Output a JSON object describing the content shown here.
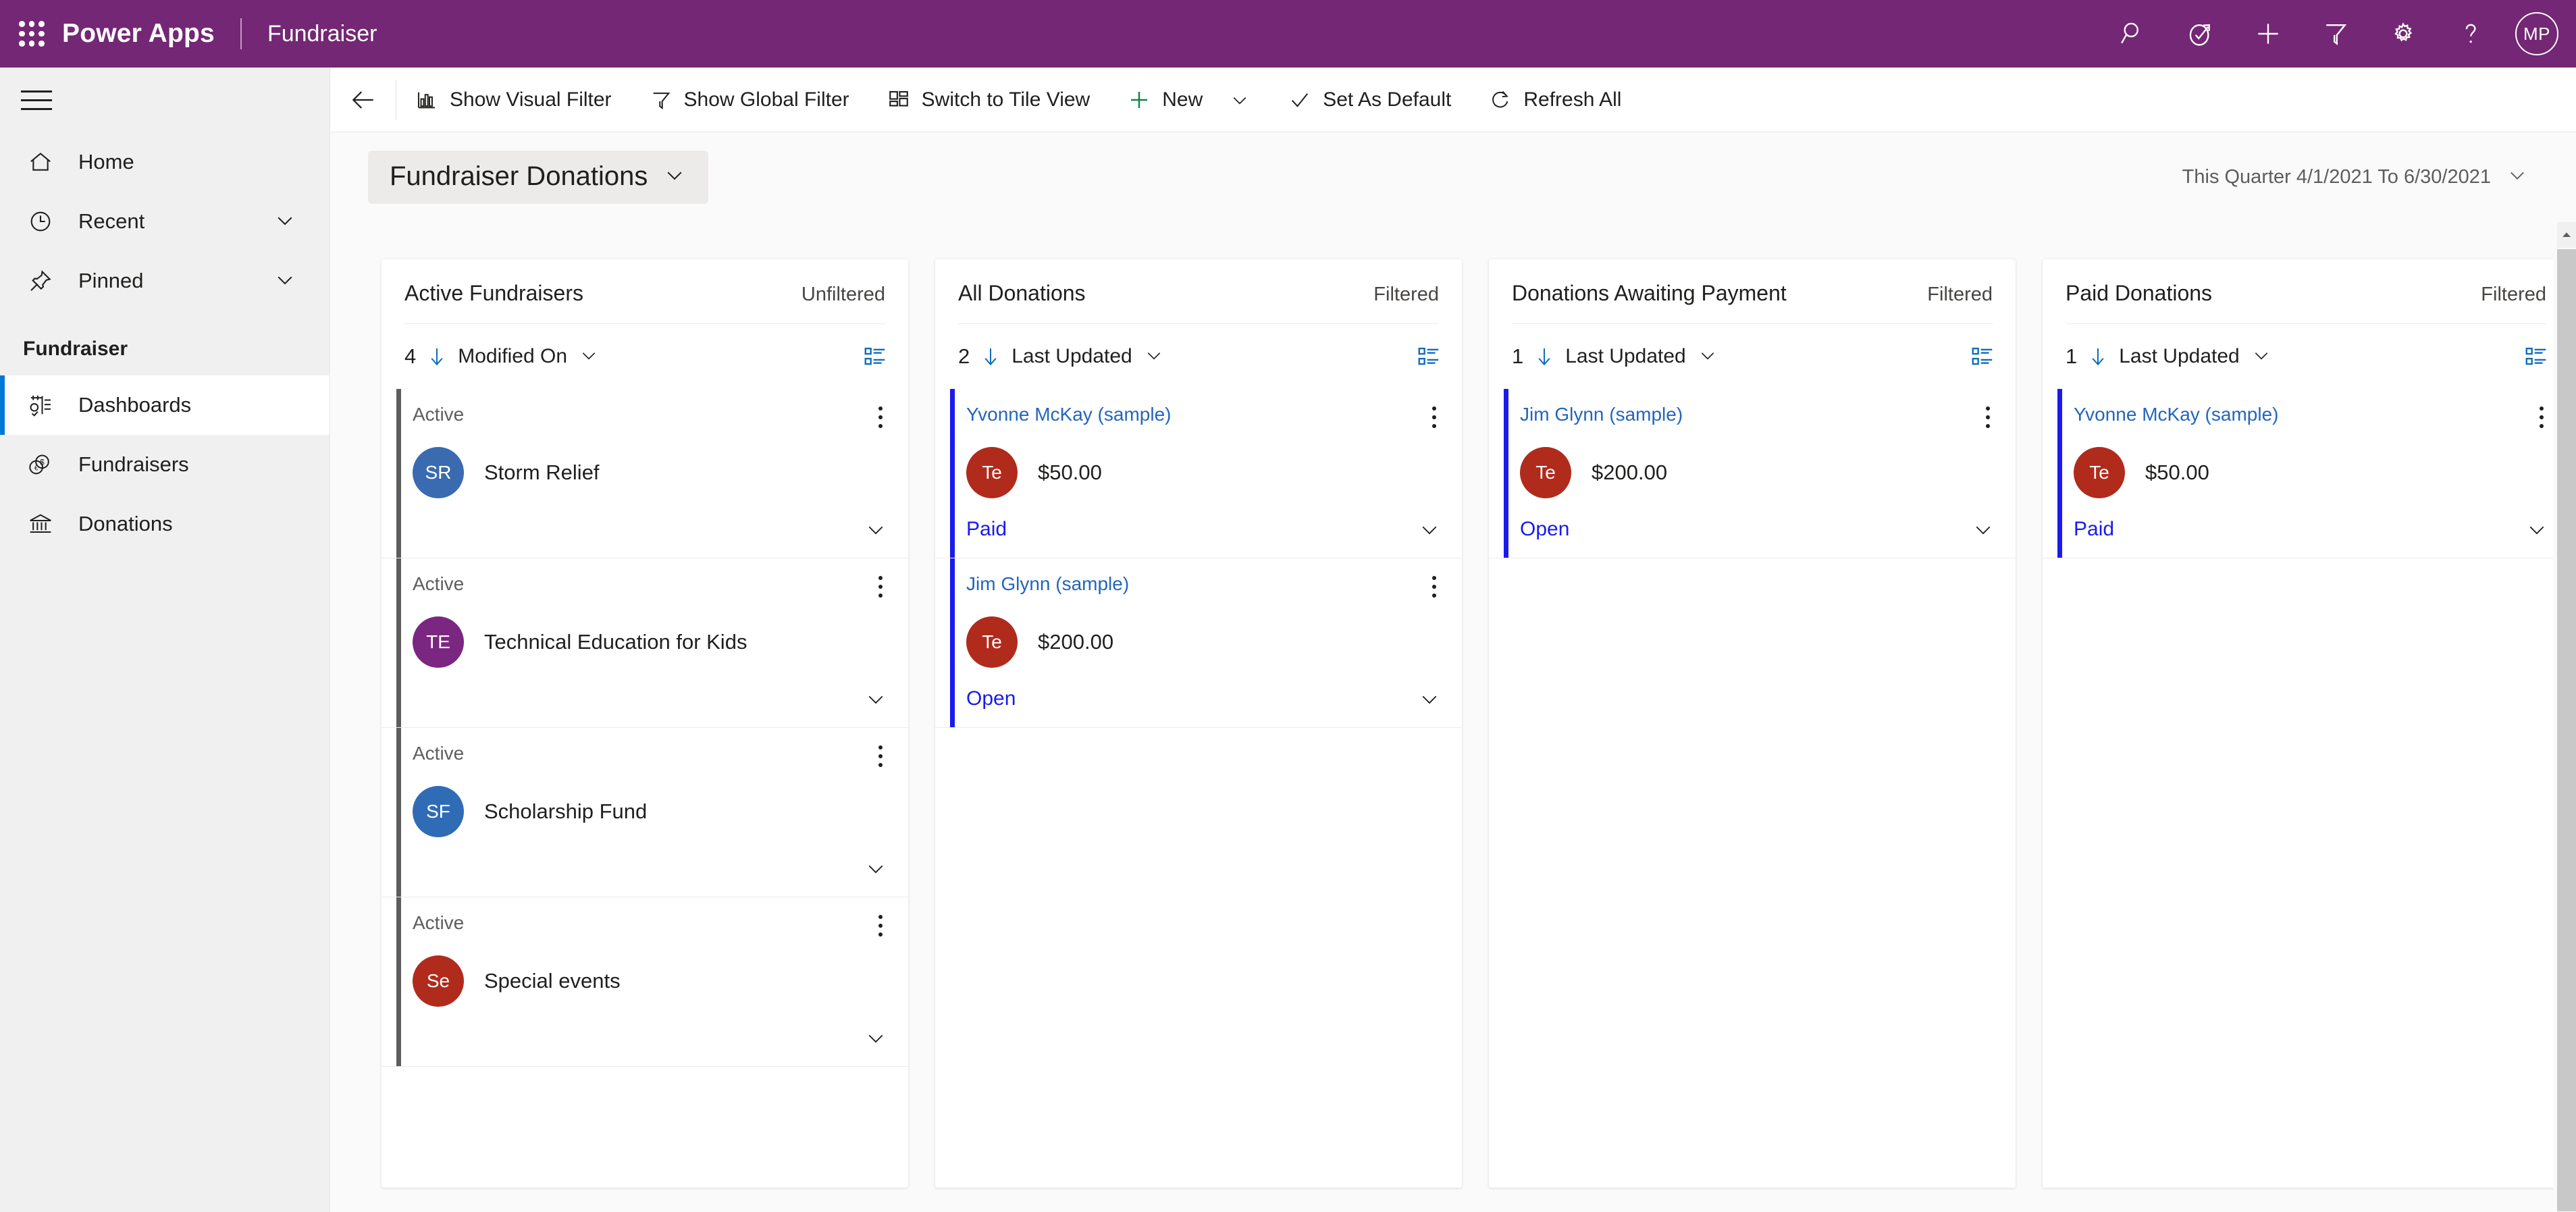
{
  "topbar": {
    "waffle_icon": "app-launcher-icon",
    "brand": "Power Apps",
    "app_name": "Fundraiser",
    "icons": [
      {
        "name": "search-icon",
        "label": "Search"
      },
      {
        "name": "assistant-icon",
        "label": "Assistant"
      },
      {
        "name": "quick-create-icon",
        "label": "New"
      },
      {
        "name": "filter-icon",
        "label": "Filter"
      },
      {
        "name": "settings-gear-icon",
        "label": "Settings"
      },
      {
        "name": "help-icon",
        "label": "Help"
      }
    ],
    "avatar_initials": "MP",
    "accent_color": "#742774"
  },
  "sidebar": {
    "hamburger_label": "Site map",
    "items": [
      {
        "label": "Home",
        "icon": "home-icon",
        "expandable": false,
        "selected": false
      },
      {
        "label": "Recent",
        "icon": "clock-icon",
        "expandable": true,
        "selected": false
      },
      {
        "label": "Pinned",
        "icon": "pin-icon",
        "expandable": true,
        "selected": false
      }
    ],
    "group_title": "Fundraiser",
    "group_items": [
      {
        "label": "Dashboards",
        "icon": "dashboard-icon",
        "selected": true
      },
      {
        "label": "Fundraisers",
        "icon": "coins-icon",
        "selected": false
      },
      {
        "label": "Donations",
        "icon": "bank-icon",
        "selected": false
      }
    ]
  },
  "commandbar": {
    "back_label": "Back",
    "buttons": [
      {
        "label": "Show Visual Filter",
        "icon": "bar-chart-icon",
        "has_chevron": false
      },
      {
        "label": "Show Global Filter",
        "icon": "funnel-icon",
        "has_chevron": false
      },
      {
        "label": "Switch to Tile View",
        "icon": "tile-view-icon",
        "has_chevron": false
      },
      {
        "label": "New",
        "icon": "plus-icon",
        "has_chevron": true
      },
      {
        "label": "Set As Default",
        "icon": "checkmark-icon",
        "has_chevron": false
      },
      {
        "label": "Refresh All",
        "icon": "refresh-icon",
        "has_chevron": false
      }
    ]
  },
  "dashboard": {
    "title": "Fundraiser Donations",
    "title_chevron": "chevron-down-icon",
    "date_range": "This Quarter 4/1/2021 To 6/30/2021",
    "date_range_chevron": "chevron-down-icon"
  },
  "panels": [
    {
      "title": "Active Fundraisers",
      "filter_state": "Unfiltered",
      "count": "4",
      "sort_field": "Modified On",
      "cards": [
        {
          "label": "Active",
          "label_is_link": false,
          "initials": "SR",
          "avatar_color": "#3a6ab0",
          "main": "Storm Relief",
          "status": "",
          "accent_color": "#5d5d5d"
        },
        {
          "label": "Active",
          "label_is_link": false,
          "initials": "TE",
          "avatar_color": "#7b2681",
          "main": "Technical Education for Kids",
          "status": "",
          "accent_color": "#5d5d5d"
        },
        {
          "label": "Active",
          "label_is_link": false,
          "initials": "SF",
          "avatar_color": "#2f6cb5",
          "main": "Scholarship Fund",
          "status": "",
          "accent_color": "#5d5d5d"
        },
        {
          "label": "Active",
          "label_is_link": false,
          "initials": "Se",
          "avatar_color": "#b02b1c",
          "main": "Special events",
          "status": "",
          "accent_color": "#5d5d5d"
        }
      ]
    },
    {
      "title": "All Donations",
      "filter_state": "Filtered",
      "count": "2",
      "sort_field": "Last Updated",
      "cards": [
        {
          "label": "Yvonne McKay (sample)",
          "label_is_link": true,
          "initials": "Te",
          "avatar_color": "#b02b1c",
          "main": "$50.00",
          "status": "Paid",
          "accent_color": "#1a1aee"
        },
        {
          "label": "Jim Glynn (sample)",
          "label_is_link": true,
          "initials": "Te",
          "avatar_color": "#b02b1c",
          "main": "$200.00",
          "status": "Open",
          "accent_color": "#1a1aee"
        }
      ]
    },
    {
      "title": "Donations Awaiting Payment",
      "filter_state": "Filtered",
      "count": "1",
      "sort_field": "Last Updated",
      "cards": [
        {
          "label": "Jim Glynn (sample)",
          "label_is_link": true,
          "initials": "Te",
          "avatar_color": "#b02b1c",
          "main": "$200.00",
          "status": "Open",
          "accent_color": "#1a1aee"
        }
      ]
    },
    {
      "title": "Paid Donations",
      "filter_state": "Filtered",
      "count": "1",
      "sort_field": "Last Updated",
      "cards": [
        {
          "label": "Yvonne McKay (sample)",
          "label_is_link": true,
          "initials": "Te",
          "avatar_color": "#b02b1c",
          "main": "$50.00",
          "status": "Paid",
          "accent_color": "#1a1aee"
        }
      ]
    }
  ]
}
